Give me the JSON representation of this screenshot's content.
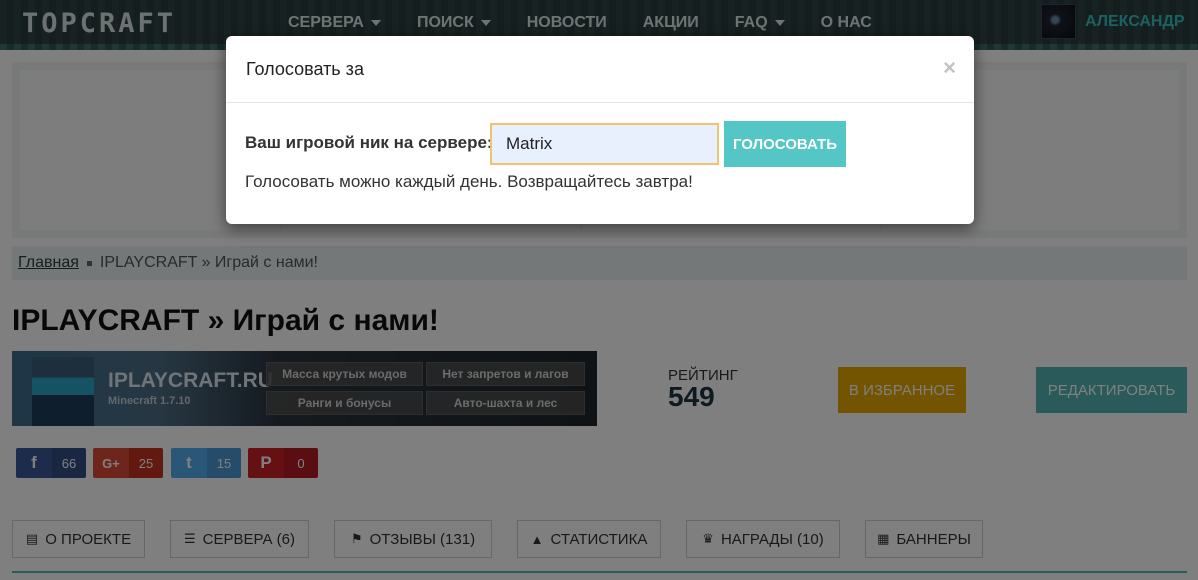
{
  "header": {
    "logo": "TOPCRAFT",
    "nav": [
      {
        "label": "СЕРВЕРА",
        "dropdown": true
      },
      {
        "label": "ПОИСК",
        "dropdown": true
      },
      {
        "label": "НОВОСТИ",
        "dropdown": false
      },
      {
        "label": "АКЦИИ",
        "dropdown": false
      },
      {
        "label": "FAQ",
        "dropdown": true
      },
      {
        "label": "О НАС",
        "dropdown": false
      }
    ],
    "user_name": "АЛЕКСАНДР"
  },
  "breadcrumb": {
    "home": "Главная",
    "current": "IPLAYCRAFT » Играй с нами!"
  },
  "page_title": "IPLAYCRAFT » Играй с нами!",
  "banner": {
    "name": "IPLAYCRAFT.RU",
    "sub": "Minecraft 1.7.10",
    "tags": [
      "Масса крутых модов",
      "Нет запретов и лагов",
      "Ранги и бонусы",
      "Авто-шахта и лес"
    ]
  },
  "rating": {
    "label": "РЕЙТИНГ",
    "value": "549"
  },
  "buttons": {
    "favorite": "В ИЗБРАННОЕ",
    "edit": "РЕДАКТИРОВАТЬ"
  },
  "social": [
    {
      "icon": "f",
      "count": "66",
      "color": "#3b5998",
      "count_color": "#344e86",
      "name": "facebook"
    },
    {
      "icon": "G+",
      "count": "25",
      "color": "#dd4b39",
      "count_color": "#c23321",
      "name": "google-plus"
    },
    {
      "icon": "t",
      "count": "15",
      "color": "#55acee",
      "count_color": "#4a9bd6",
      "name": "twitter"
    },
    {
      "icon": "P",
      "count": "0",
      "color": "#cb2027",
      "count_color": "#b51c22",
      "name": "pinterest"
    }
  ],
  "tabs": [
    {
      "icon": "▤",
      "label": "О ПРОЕКТЕ"
    },
    {
      "icon": "☰",
      "label": "СЕРВЕРА (6)"
    },
    {
      "icon": "⚑",
      "label": "ОТЗЫВЫ (131)"
    },
    {
      "icon": "▲",
      "label": "СТАТИСТИКА"
    },
    {
      "icon": "♛",
      "label": "НАГРАДЫ (10)"
    },
    {
      "icon": "▦",
      "label": "БАННЕРЫ"
    }
  ],
  "modal": {
    "title": "Голосовать за",
    "close": "×",
    "label": "Ваш игровой ник на сервере:",
    "input_value": "Matrix",
    "vote_button": "ГОЛОСОВАТЬ",
    "message": "Голосовать можно каждый день. Возвращайтесь завтра!"
  }
}
